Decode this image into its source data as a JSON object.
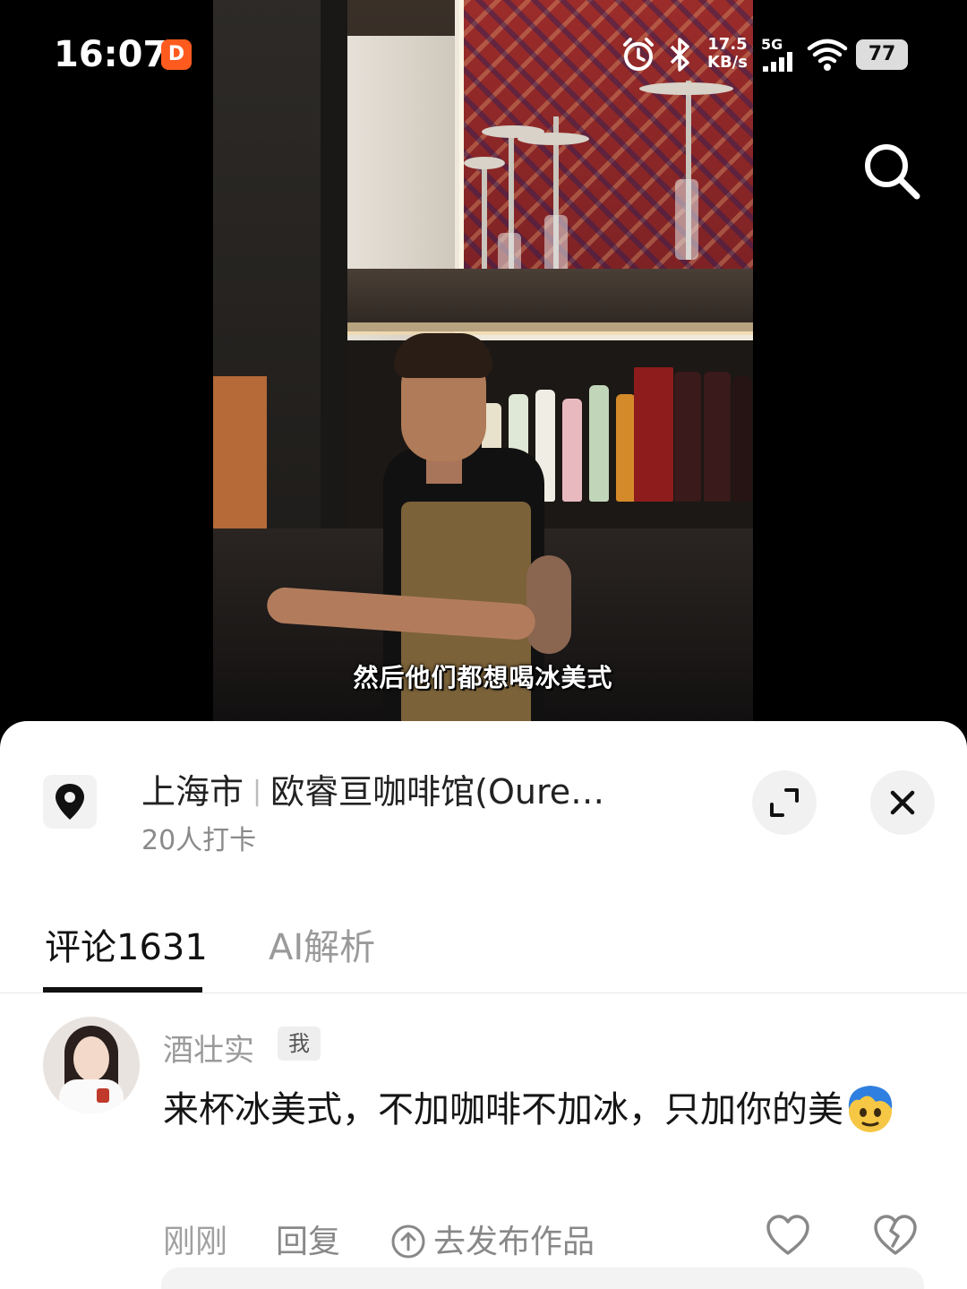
{
  "status_bar": {
    "time": "16:07",
    "app_badge": "D",
    "net_speed_value": "17.5",
    "net_speed_unit": "KB/s",
    "net_type": "5G",
    "battery": "77"
  },
  "video": {
    "subtitle": "然后他们都想喝冰美式"
  },
  "poi": {
    "city": "上海市",
    "name": "欧睿亘咖啡馆(Oure…",
    "checkins": "20人打卡"
  },
  "tabs": [
    {
      "label": "评论1631"
    },
    {
      "label": "AI解析"
    }
  ],
  "comment": {
    "username": "酒壮实",
    "badge": "我",
    "text": "来杯冰美式，不加咖啡不加冰，只加你的美",
    "emoji": "face-with-hair-emoji",
    "time": "刚刚",
    "reply": "回复",
    "publish": "去发布作品"
  },
  "colors": {
    "sheet_bg": "#ffffff",
    "tab_active": "#111111",
    "tab_inactive": "#9a9a9a",
    "muted_text": "#888888"
  }
}
